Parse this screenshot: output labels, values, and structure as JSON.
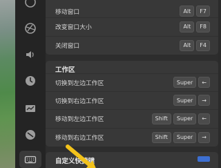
{
  "sidebar": {
    "icons": [
      "network-icon",
      "sound-icon",
      "power-icon",
      "display-icon",
      "mouse-icon",
      "keyboard-icon"
    ]
  },
  "window_group": {
    "rows": [
      {
        "label": "移动窗口",
        "keys": [
          "Alt",
          "F7"
        ]
      },
      {
        "label": "改变窗口大小",
        "keys": [
          "Alt",
          "F8"
        ]
      },
      {
        "label": "关闭窗口",
        "keys": [
          "Alt",
          "F4"
        ]
      }
    ]
  },
  "workspace_group": {
    "title": "工作区",
    "rows": [
      {
        "label": "切换到左边工作区",
        "keys": [
          "Super",
          "←"
        ]
      },
      {
        "label": "切换到右边工作区",
        "keys": [
          "Super",
          "→"
        ]
      },
      {
        "label": "移动到左边工作区",
        "keys": [
          "Shift",
          "Super",
          "←"
        ]
      },
      {
        "label": "移动到右边工作区",
        "keys": [
          "Shift",
          "Super",
          "→"
        ]
      }
    ]
  },
  "custom": {
    "label": "自定义快捷键"
  },
  "colors": {
    "accent": "#3d6fd1",
    "pointer": "#f2c21b"
  }
}
